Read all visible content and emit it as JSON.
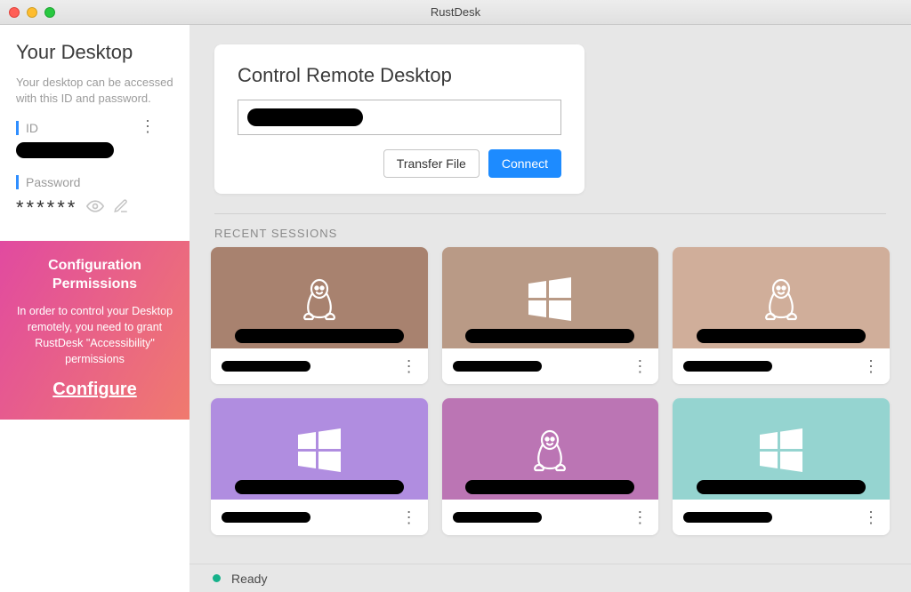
{
  "window": {
    "title": "RustDesk"
  },
  "sidebar": {
    "title": "Your Desktop",
    "desc": "Your desktop can be accessed with this ID and password.",
    "id_label": "ID",
    "pw_label": "Password",
    "pw_mask": "******",
    "perm_title_l1": "Configuration",
    "perm_title_l2": "Permissions",
    "perm_body": "In order to control your Desktop remotely, you need to grant RustDesk \"Accessibility\" permissions",
    "perm_action": "Configure"
  },
  "control": {
    "title": "Control Remote Desktop",
    "transfer_label": "Transfer File",
    "connect_label": "Connect"
  },
  "recent": {
    "label": "RECENT SESSIONS",
    "sessions": [
      {
        "os": "linux",
        "bg": "#a8826f"
      },
      {
        "os": "windows",
        "bg": "#b99a86"
      },
      {
        "os": "linux",
        "bg": "#d0ae9a"
      },
      {
        "os": "windows",
        "bg": "#b08de0"
      },
      {
        "os": "linux",
        "bg": "#bb75b4"
      },
      {
        "os": "windows",
        "bg": "#95d4d0"
      }
    ]
  },
  "status": {
    "text": "Ready",
    "color": "#16b18a"
  }
}
